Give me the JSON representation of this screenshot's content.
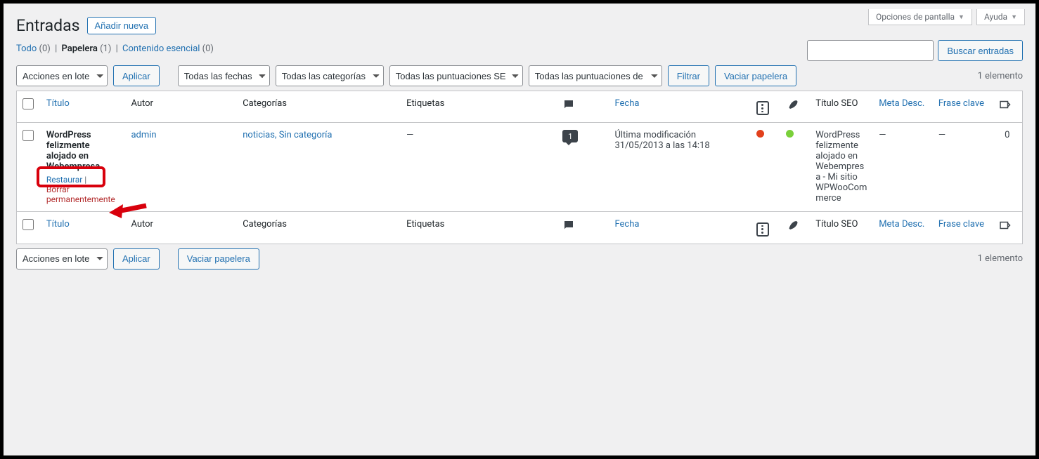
{
  "screen_meta": {
    "options": "Opciones de pantalla",
    "help": "Ayuda"
  },
  "heading": "Entradas",
  "add_new": "Añadir nueva",
  "views": {
    "all": {
      "label": "Todo",
      "count": "(0)"
    },
    "trash": {
      "label": "Papelera",
      "count": "(1)"
    },
    "cornerstone": {
      "label": "Contenido esencial",
      "count": "(0)"
    }
  },
  "bulk_action": "Acciones en lote",
  "apply": "Aplicar",
  "filters": {
    "dates": "Todas las fechas",
    "cats": "Todas las categorías",
    "seo": "Todas las puntuaciones SEO",
    "read": "Todas las puntuaciones de"
  },
  "filter_btn": "Filtrar",
  "empty_trash": "Vaciar papelera",
  "search_btn": "Buscar entradas",
  "num_items": "1 elemento",
  "columns": {
    "title": "Título",
    "author": "Autor",
    "categories": "Categorías",
    "tags": "Etiquetas",
    "date": "Fecha",
    "seo_title": "Título SEO",
    "meta_desc": "Meta Desc.",
    "keyphrase": "Frase clave"
  },
  "row": {
    "title": "WordPress felizmente alojado en Webempresa",
    "author": "admin",
    "categories": "noticias, Sin categoría",
    "tags": "—",
    "comments": "1",
    "date_label": "Última modificación",
    "date_value": "31/05/2013 a las 14:18",
    "seo_title": "WordPress felizmente alojado en Webempresa - Mi sitio WPWooCommerce",
    "meta_desc": "—",
    "keyphrase": "—",
    "links": "0",
    "actions": {
      "restore": "Restaurar",
      "delete": "Borrar permanentemente"
    }
  }
}
